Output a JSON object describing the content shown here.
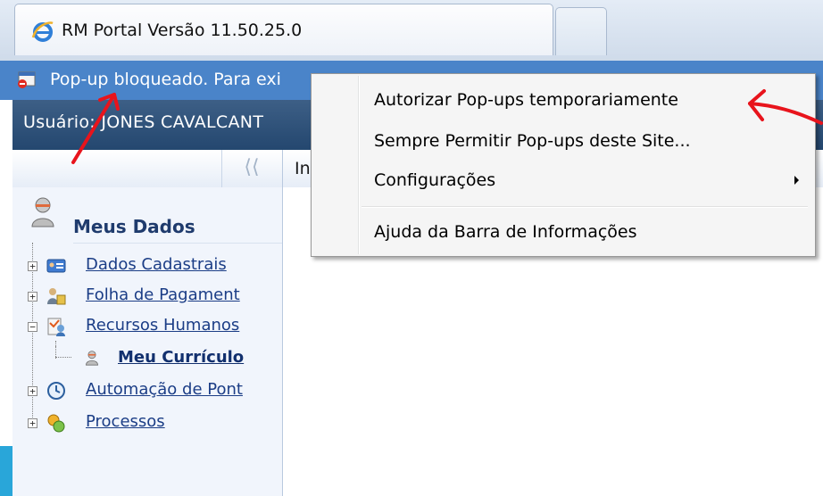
{
  "browser": {
    "tab_title": "RM Portal Versão 11.50.25.0",
    "tab_icon": "ie-icon"
  },
  "infobar": {
    "text": "Pop-up bloqueado. Para exi",
    "icon": "popup-blocked-icon"
  },
  "userbar": {
    "text": "Usuário: JONES CAVALCANT"
  },
  "content": {
    "toolbar_text": "In"
  },
  "sidebar": {
    "collapse_glyph": "⟨⟨",
    "section_title": "Meus Dados",
    "items": [
      {
        "label": "Dados Cadastrais",
        "expander": "+"
      },
      {
        "label": "Folha de Pagament",
        "expander": "+"
      },
      {
        "label": "Recursos Humanos",
        "expander": "−"
      },
      {
        "label": "Meu Currículo",
        "expander": ""
      },
      {
        "label": "Automação de Pont",
        "expander": "+"
      },
      {
        "label": "Processos",
        "expander": "+"
      }
    ]
  },
  "context_menu": {
    "items": [
      {
        "label": "Autorizar Pop-ups temporariamente"
      },
      {
        "label": "Sempre Permitir Pop-ups deste Site..."
      },
      {
        "label": "Configurações",
        "submenu": true
      },
      {
        "label": "Ajuda da Barra de Informações"
      }
    ]
  },
  "colors": {
    "infobar": "#4a84c9",
    "userbar": "#24476f",
    "link": "#1b3d86",
    "annotation": "#e8141c"
  }
}
